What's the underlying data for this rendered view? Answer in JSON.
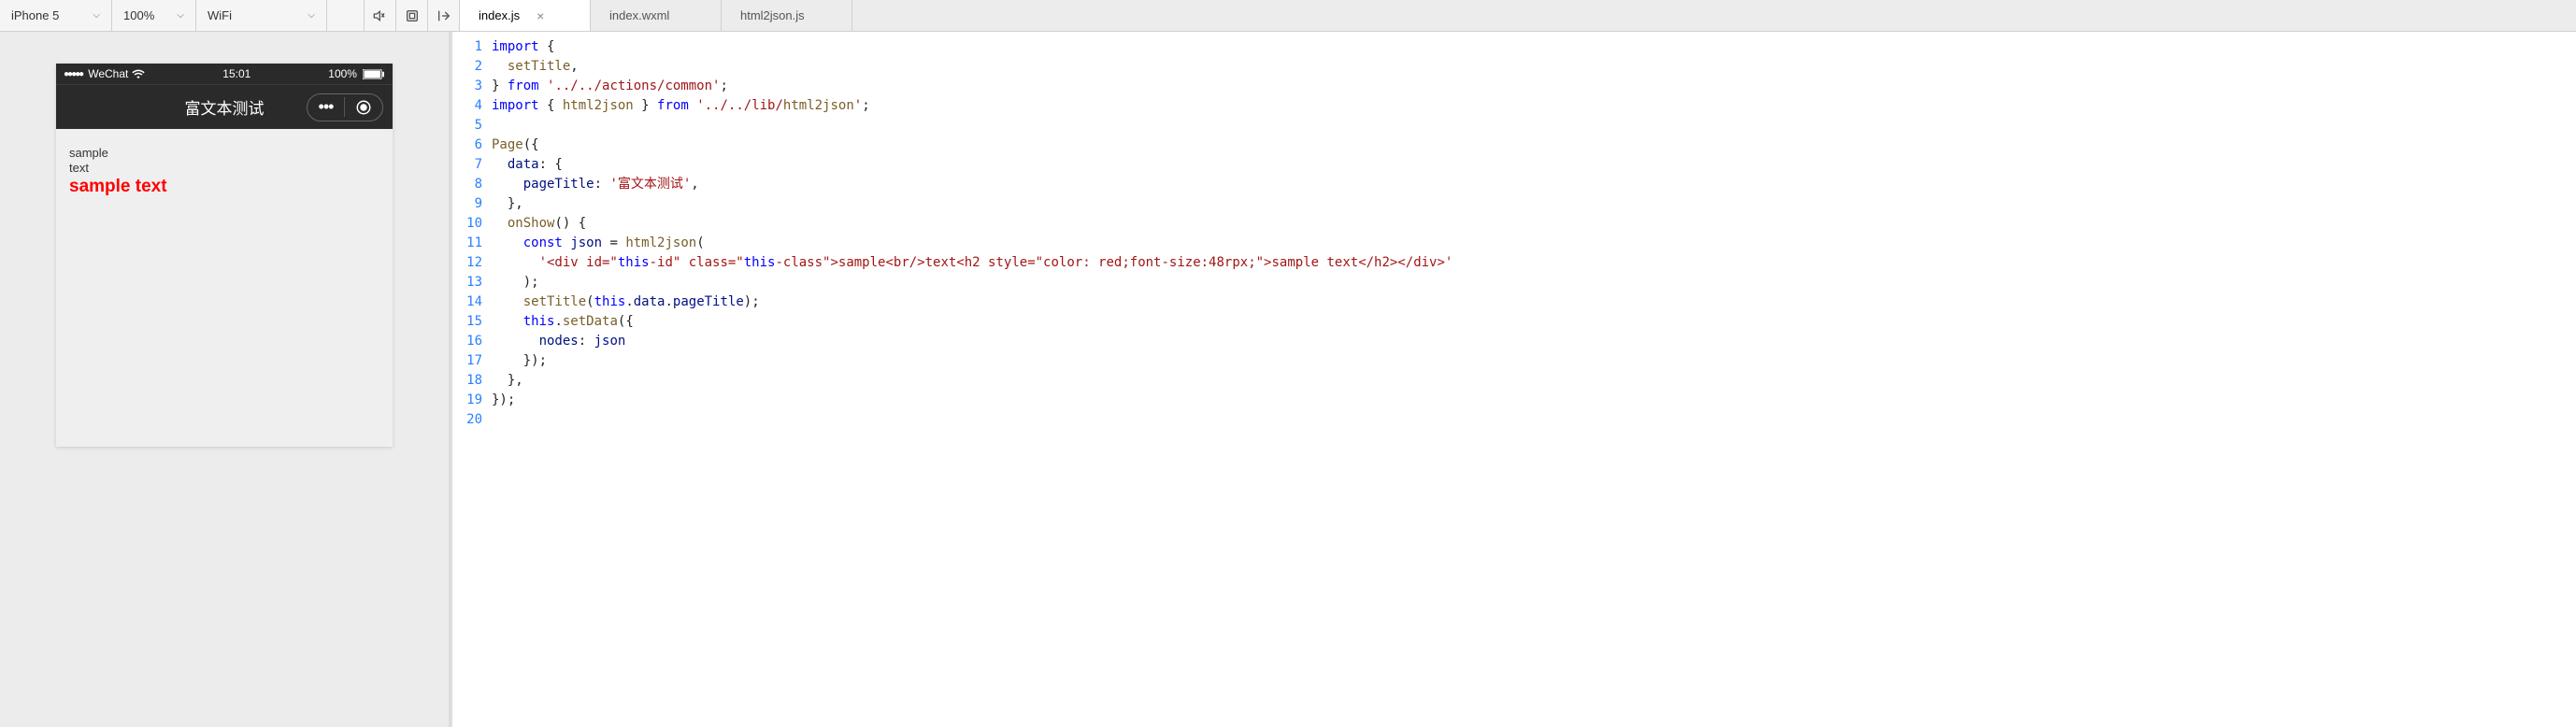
{
  "toolbar": {
    "device": "iPhone 5",
    "zoom": "100%",
    "network": "WiFi"
  },
  "tabs": [
    {
      "label": "index.js",
      "active": true,
      "closable": true
    },
    {
      "label": "index.wxml",
      "active": false,
      "closable": false
    },
    {
      "label": "html2json.js",
      "active": false,
      "closable": false
    }
  ],
  "simulator": {
    "carrier": "WeChat",
    "time": "15:01",
    "battery": "100%",
    "title": "富文本测试",
    "body_line1": "sample",
    "body_line2": "text",
    "body_red": "sample text"
  },
  "code": {
    "lines": [
      "import {",
      "  setTitle,",
      "} from '../../actions/common';",
      "import { html2json } from '../../lib/html2json';",
      "",
      "Page({",
      "  data: {",
      "    pageTitle: '富文本测试',",
      "  },",
      "  onShow() {",
      "    const json = html2json(",
      "      '<div id=\"this-id\" class=\"this-class\">sample<br/>text<h2 style=\"color: red;font-size:48rpx;\">sample text</h2></div>'",
      "    );",
      "    setTitle(this.data.pageTitle);",
      "    this.setData({",
      "      nodes: json",
      "    });",
      "  },",
      "});",
      ""
    ]
  }
}
